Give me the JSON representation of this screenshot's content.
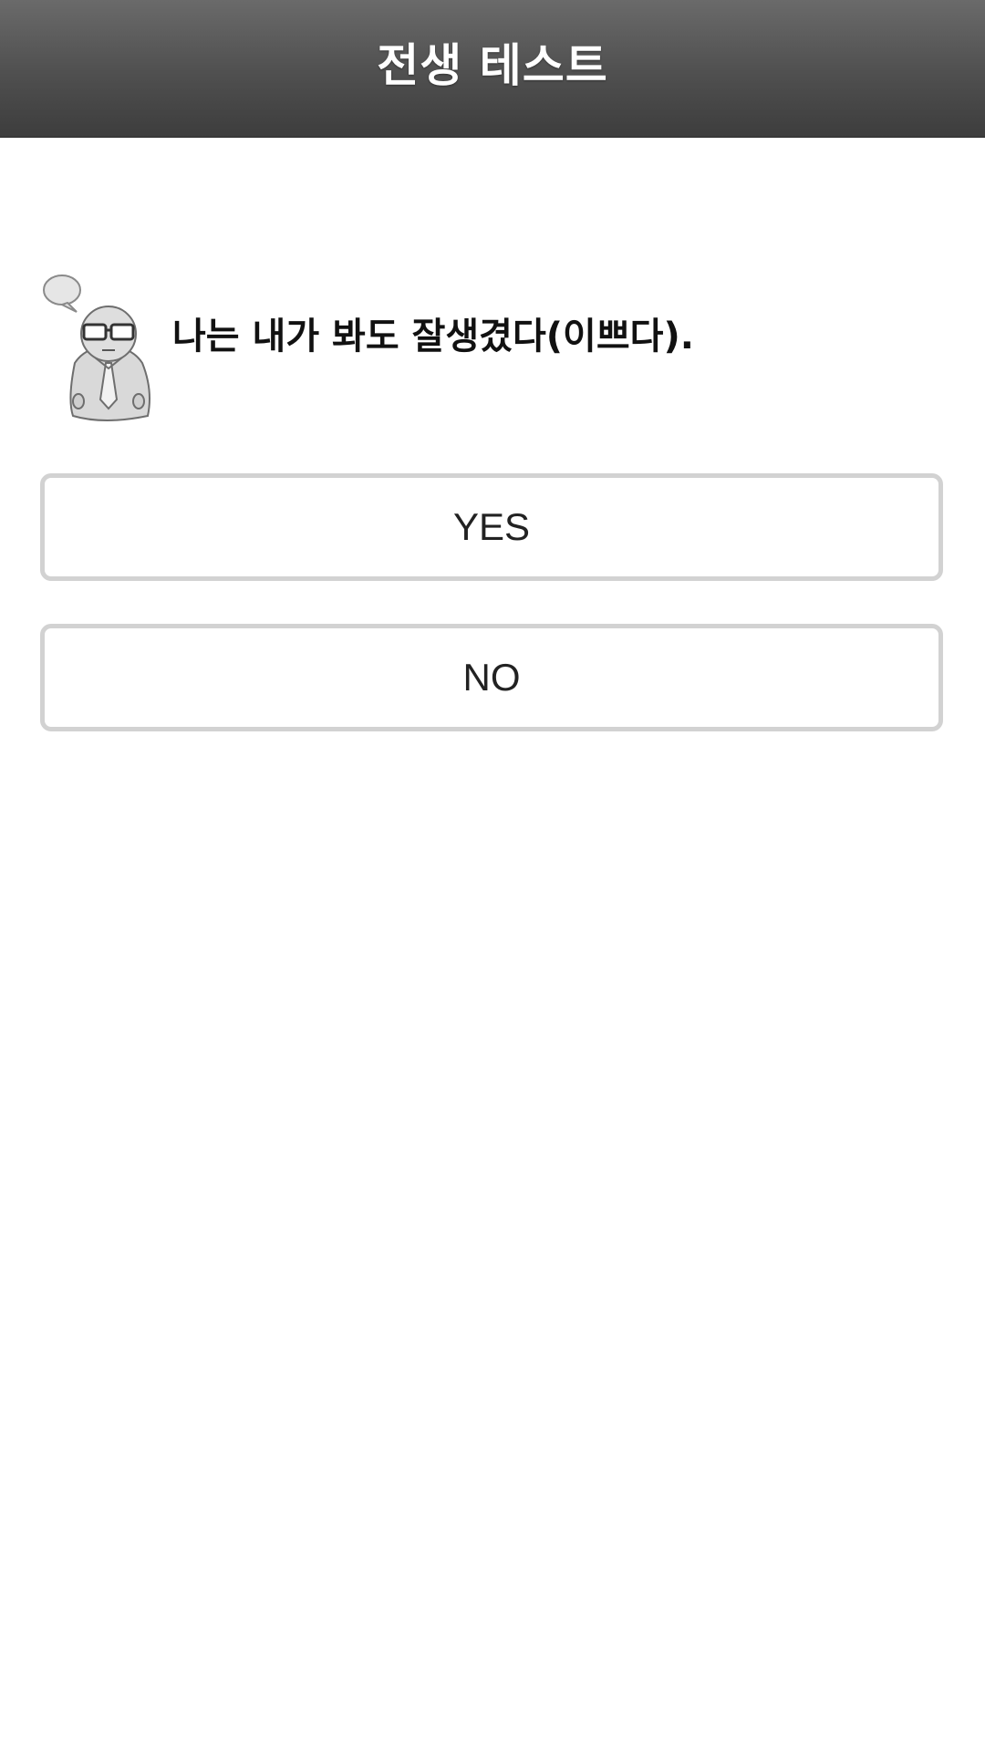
{
  "header": {
    "title": "전생 테스트"
  },
  "question": {
    "text": "나는 내가 봐도 잘생겼다(이쁘다).",
    "icon": "thinking-man-icon"
  },
  "answers": {
    "yes_label": "YES",
    "no_label": "NO"
  },
  "colors": {
    "header_top": "#6a6a6a",
    "header_bottom": "#3d3d3d",
    "button_border": "#d2d2d2"
  }
}
